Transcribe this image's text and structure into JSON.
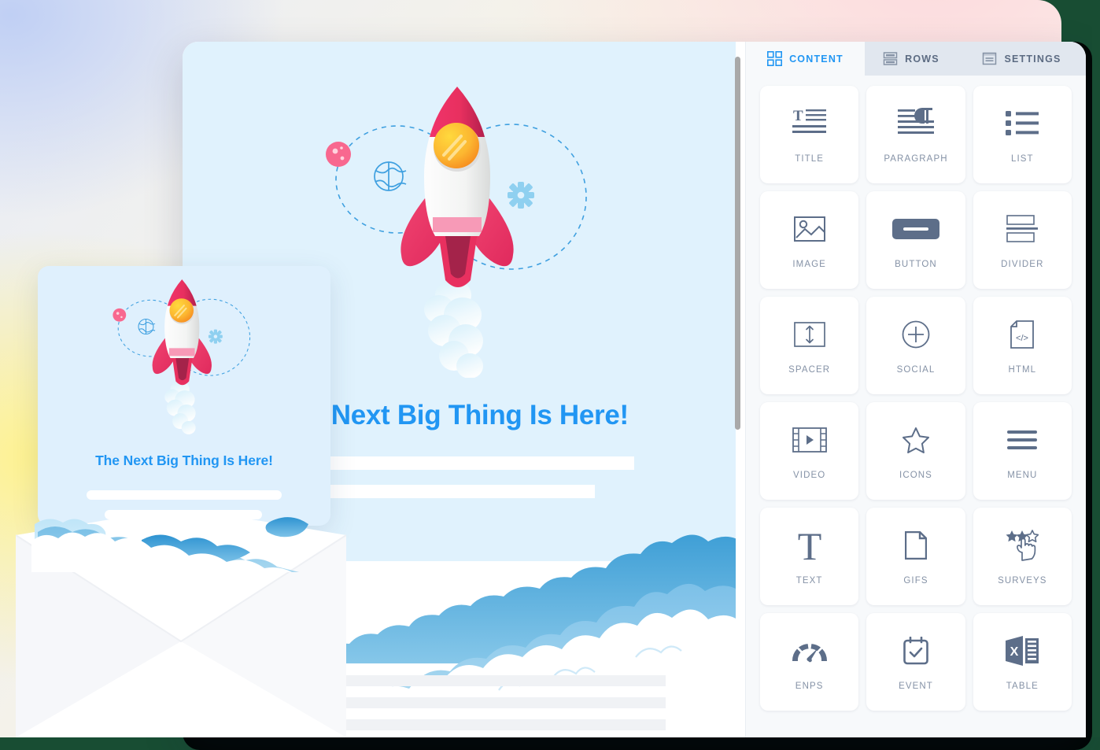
{
  "background": {
    "gradient_colors": [
      "#bece f4",
      "#fff28c",
      "#fddbde"
    ],
    "accent_blue": "#2196f3",
    "panel_bg": "#f7f9fb",
    "tab_inactive_bg": "#e1e7ef",
    "icon_color": "#5d6e89",
    "label_color": "#8592a6"
  },
  "editor": {
    "tabs": [
      {
        "id": "content",
        "label": "CONTENT",
        "icon": "grid-icon",
        "active": true
      },
      {
        "id": "rows",
        "label": "ROWS",
        "icon": "rows-icon",
        "active": false
      },
      {
        "id": "settings",
        "label": "SETTINGS",
        "icon": "settings-icon",
        "active": false
      }
    ],
    "blocks": [
      {
        "label": "TITLE",
        "icon": "title-icon"
      },
      {
        "label": "PARAGRAPH",
        "icon": "paragraph-icon"
      },
      {
        "label": "LIST",
        "icon": "list-icon"
      },
      {
        "label": "IMAGE",
        "icon": "image-icon"
      },
      {
        "label": "BUTTON",
        "icon": "button-icon"
      },
      {
        "label": "DIVIDER",
        "icon": "divider-icon"
      },
      {
        "label": "SPACER",
        "icon": "spacer-icon"
      },
      {
        "label": "SOCIAL",
        "icon": "social-plus-icon"
      },
      {
        "label": "HTML",
        "icon": "html-file-icon"
      },
      {
        "label": "VIDEO",
        "icon": "video-icon"
      },
      {
        "label": "ICONS",
        "icon": "star-icon"
      },
      {
        "label": "MENU",
        "icon": "hamburger-menu-icon"
      },
      {
        "label": "TEXT",
        "icon": "text-t-icon"
      },
      {
        "label": "GIFS",
        "icon": "gif-file-icon"
      },
      {
        "label": "SURVEYS",
        "icon": "survey-stars-hand-icon"
      },
      {
        "label": "ENPS",
        "icon": "gauge-icon"
      },
      {
        "label": "EVENT",
        "icon": "calendar-check-icon"
      },
      {
        "label": "TABLE",
        "icon": "excel-table-icon"
      }
    ],
    "scrollbar": {
      "name": "vertical-scrollbar",
      "position_percent": 0
    }
  },
  "email_preview": {
    "headline": "The Next Big Thing Is Here!",
    "hero_illustration": "rocket-launch-illustration",
    "text_placeholder_bars": 2,
    "body_placeholder_bars": 3,
    "cloud_band": "clouds-illustration"
  },
  "mobile_preview": {
    "headline": "The Next Big Thing Is Here!",
    "hero_illustration": "rocket-launch-illustration",
    "text_placeholder_bars": 2
  },
  "envelope": {
    "name": "open-envelope-illustration"
  }
}
